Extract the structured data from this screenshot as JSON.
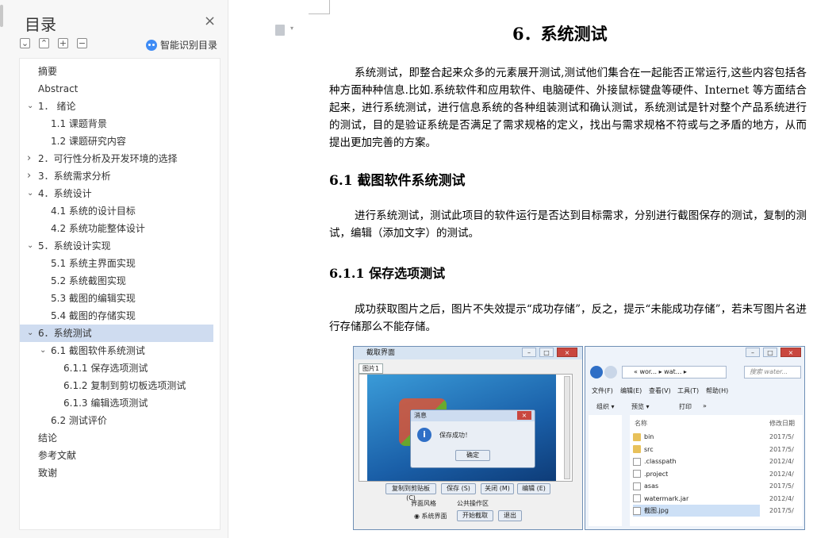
{
  "toc": {
    "title": "目录",
    "close": "×",
    "toolbar": {
      "collapse": "⌄",
      "expand": "⌃",
      "add": "+",
      "remove": "−"
    },
    "smart_label": "智能识别目录",
    "items": [
      {
        "label": "摘要",
        "level": 0
      },
      {
        "label": "Abstract",
        "level": 0
      },
      {
        "label": "1． 绪论",
        "level": 0,
        "chevron": "expanded"
      },
      {
        "label": "1.1 课题背景",
        "level": 1
      },
      {
        "label": "1.2 课题研究内容",
        "level": 1
      },
      {
        "label": "2．可行性分析及开发环境的选择",
        "level": 0,
        "chevron": "collapsed"
      },
      {
        "label": "3．系统需求分析",
        "level": 0,
        "chevron": "collapsed"
      },
      {
        "label": "4．系统设计",
        "level": 0,
        "chevron": "expanded"
      },
      {
        "label": "4.1 系统的设计目标",
        "level": 1
      },
      {
        "label": "4.2 系统功能整体设计",
        "level": 1
      },
      {
        "label": "5．系统设计实现",
        "level": 0,
        "chevron": "expanded"
      },
      {
        "label": "5.1 系统主界面实现",
        "level": 1
      },
      {
        "label": "5.2 系统截图实现",
        "level": 1
      },
      {
        "label": "5.3 截图的编辑实现",
        "level": 1
      },
      {
        "label": "5.4 截图的存储实现",
        "level": 1
      },
      {
        "label": "6．系统测试",
        "level": 0,
        "chevron": "expanded",
        "active": true
      },
      {
        "label": "6.1 截图软件系统测试",
        "level": 1,
        "chevron": "expanded"
      },
      {
        "label": "6.1.1 保存选项测试",
        "level": 2
      },
      {
        "label": "6.1.2 复制到剪切板选项测试",
        "level": 2
      },
      {
        "label": "6.1.3 编辑选项测试",
        "level": 2
      },
      {
        "label": "6.2 测试评价",
        "level": 1
      },
      {
        "label": "结论",
        "level": 0
      },
      {
        "label": "参考文献",
        "level": 0
      },
      {
        "label": "致谢",
        "level": 0
      }
    ]
  },
  "doc": {
    "icon_caret": "▾",
    "heading1": "6．系统测试",
    "para1": "系统测试，即整合起来众多的元素展开测试,测试他们集合在一起能否正常运行,这些内容包括各种方面种种信息.比如.系统软件和应用软件、电脑硬件、外接鼠标键盘等硬件、Internet 等方面结合起来，进行系统测试，进行信息系统的各种组装测试和确认测试，系统测试是针对整个产品系统进行的测试，目的是验证系统是否满足了需求规格的定义，找出与需求规格不符或与之矛盾的地方，从而提出更加完善的方案。",
    "heading2": "6.1 截图软件系统测试",
    "para2": "进行系统测试，测试此项目的软件运行是否达到目标需求，分别进行截图保存的测试，复制的测试，编辑（添加文字）的测试。",
    "heading3": "6.1.1 保存选项测试",
    "para3": "成功获取图片之后，图片不失效提示“成功存储”，反之，提示“未能成功存储”，若未写图片名进行存储那么不能存储。"
  },
  "figure": {
    "app": {
      "title": "截取界面",
      "tab": "图片1",
      "dialog_title": "消息",
      "dialog_text": "保存成功！",
      "dialog_ok": "确定",
      "buttons": [
        "复制到剪贴板 (C)",
        "保存 (S)",
        "关闭 (M)",
        "编辑 (E)"
      ],
      "style_label": "界面风格",
      "common_label": "公共操作区",
      "radio_label": "系统界面",
      "start_btn": "开始截取",
      "exit_btn": "退出"
    },
    "explorer": {
      "path": "« wor... ▸ wat... ▸",
      "search_placeholder": "搜索 water...",
      "menu": [
        "文件(F)",
        "编辑(E)",
        "查看(V)",
        "工具(T)",
        "帮助(H)"
      ],
      "toolbar": [
        "组织 ▾",
        "预览 ▾",
        "打印",
        "»"
      ],
      "col_name": "名称",
      "col_date": "修改日期",
      "files": [
        {
          "name": "bin",
          "date": "2017/5/",
          "type": "folder"
        },
        {
          "name": "src",
          "date": "2017/5/",
          "type": "folder"
        },
        {
          "name": ".classpath",
          "date": "2012/4/",
          "type": "file"
        },
        {
          "name": ".project",
          "date": "2012/4/",
          "type": "file"
        },
        {
          "name": "asas",
          "date": "2017/5/",
          "type": "file"
        },
        {
          "name": "watermark.jar",
          "date": "2012/4/",
          "type": "file"
        },
        {
          "name": "截图.jpg",
          "date": "2017/5/",
          "type": "file"
        }
      ]
    }
  }
}
